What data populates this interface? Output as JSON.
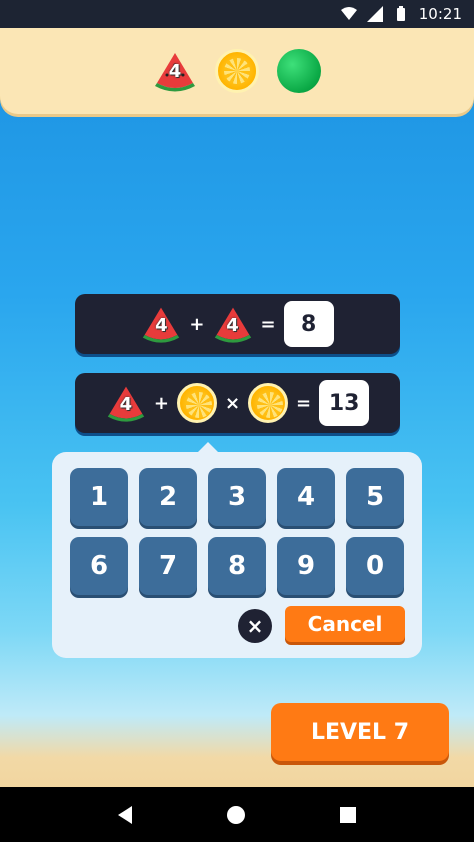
{
  "status_bar": {
    "time": "10:21"
  },
  "target": {
    "melon_number": "4"
  },
  "equations": [
    {
      "a": "4",
      "op1": "+",
      "b": "4",
      "eq": "=",
      "result": "8"
    },
    {
      "a": "4",
      "op1": "+",
      "op2": "×",
      "eq": "=",
      "result": "13"
    }
  ],
  "keypad": {
    "keys": [
      "1",
      "2",
      "3",
      "4",
      "5",
      "6",
      "7",
      "8",
      "9",
      "0"
    ],
    "clear_icon": "×",
    "cancel_label": "Cancel"
  },
  "level_label": "LEVEL 7",
  "colors": {
    "accent": "#ff7a14",
    "key": "#3d6d9a",
    "panel": "#1f2233"
  }
}
